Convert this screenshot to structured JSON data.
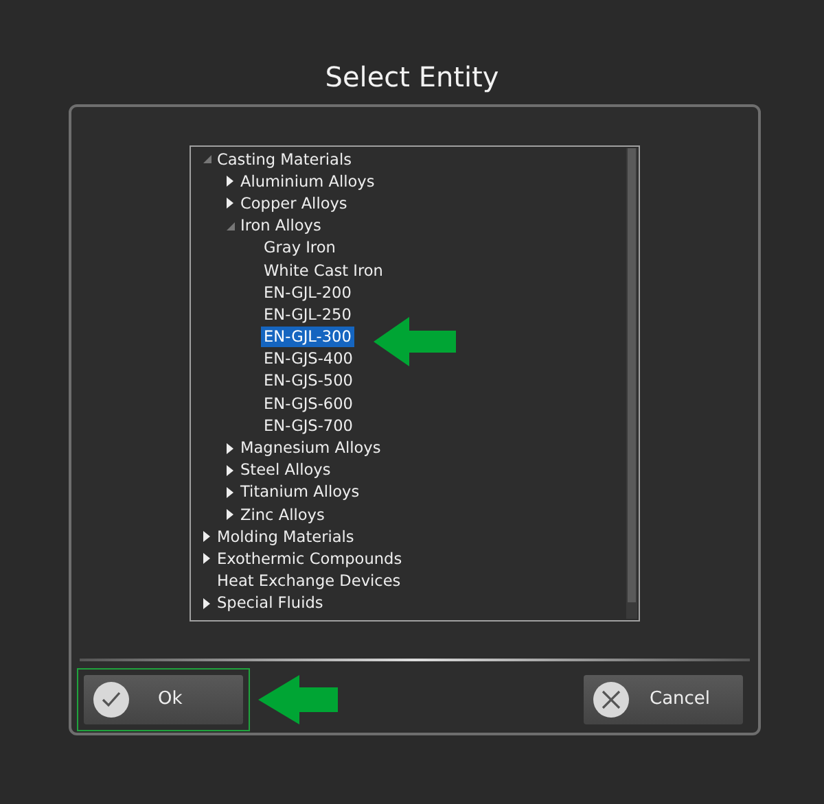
{
  "dialog": {
    "title": "Select Entity"
  },
  "tree": [
    {
      "label": "Casting Materials",
      "kind": "group",
      "expanded": true,
      "selected": false,
      "children": [
        {
          "label": "Aluminium Alloys",
          "kind": "group",
          "expanded": false,
          "selected": false
        },
        {
          "label": "Copper Alloys",
          "kind": "group",
          "expanded": false,
          "selected": false
        },
        {
          "label": "Iron Alloys",
          "kind": "group",
          "expanded": true,
          "selected": false,
          "children": [
            {
              "label": "Gray Iron",
              "kind": "leaf",
              "selected": false
            },
            {
              "label": "White Cast Iron",
              "kind": "leaf",
              "selected": false
            },
            {
              "label": "EN-GJL-200",
              "kind": "leaf",
              "selected": false
            },
            {
              "label": "EN-GJL-250",
              "kind": "leaf",
              "selected": false
            },
            {
              "label": "EN-GJL-300",
              "kind": "leaf",
              "selected": true
            },
            {
              "label": "EN-GJS-400",
              "kind": "leaf",
              "selected": false
            },
            {
              "label": "EN-GJS-500",
              "kind": "leaf",
              "selected": false
            },
            {
              "label": "EN-GJS-600",
              "kind": "leaf",
              "selected": false
            },
            {
              "label": "EN-GJS-700",
              "kind": "leaf",
              "selected": false
            }
          ]
        },
        {
          "label": "Magnesium Alloys",
          "kind": "group",
          "expanded": false,
          "selected": false
        },
        {
          "label": "Steel Alloys",
          "kind": "group",
          "expanded": false,
          "selected": false
        },
        {
          "label": "Titanium Alloys",
          "kind": "group",
          "expanded": false,
          "selected": false
        },
        {
          "label": "Zinc Alloys",
          "kind": "group",
          "expanded": false,
          "selected": false
        }
      ]
    },
    {
      "label": "Molding Materials",
      "kind": "group",
      "expanded": false,
      "selected": false
    },
    {
      "label": "Exothermic Compounds",
      "kind": "group",
      "expanded": false,
      "selected": false
    },
    {
      "label": "Heat Exchange Devices",
      "kind": "leaf",
      "selected": false
    },
    {
      "label": "Special Fluids",
      "kind": "group",
      "expanded": false,
      "selected": false
    }
  ],
  "buttons": [
    {
      "label": "Ok",
      "kind": "ok",
      "highlighted": true
    },
    {
      "label": "Cancel",
      "kind": "cancel",
      "highlighted": false
    }
  ]
}
